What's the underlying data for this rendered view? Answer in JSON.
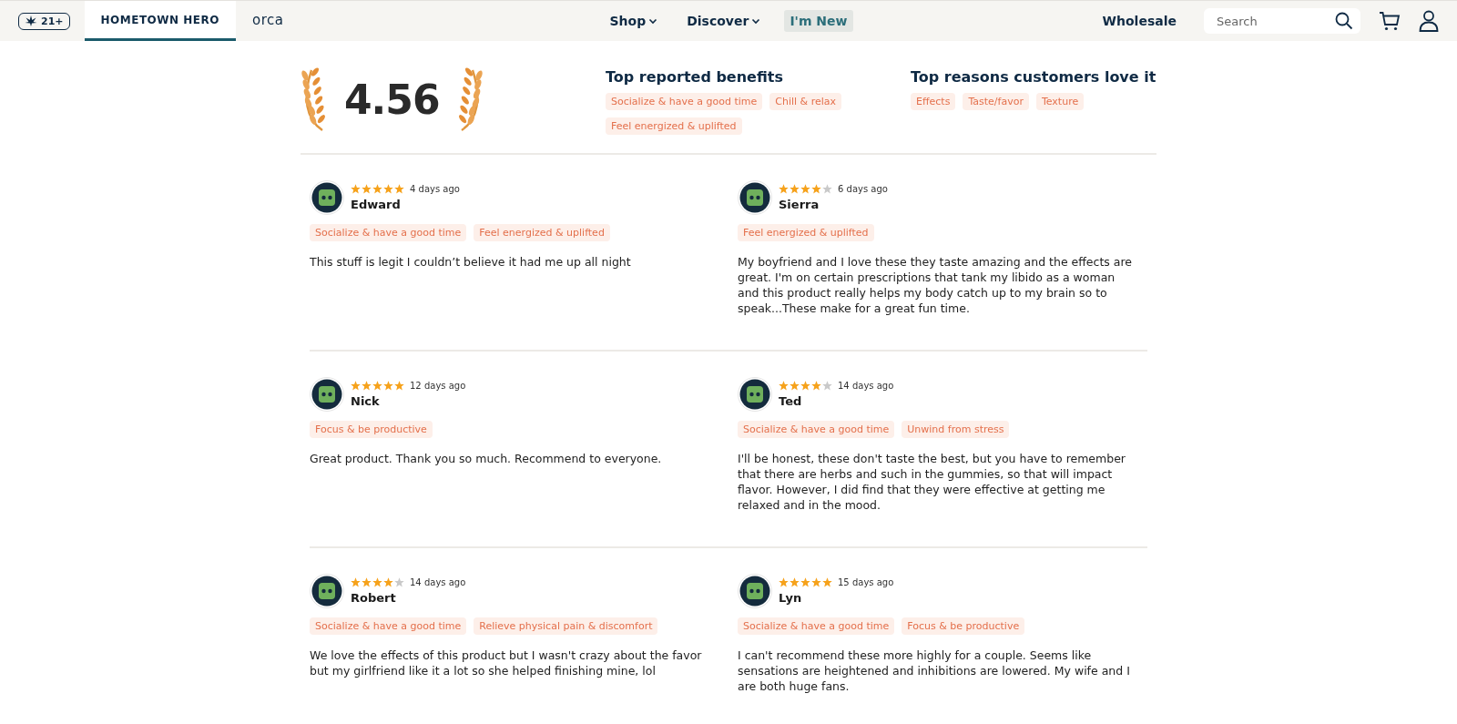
{
  "nav": {
    "age_badge": "21+",
    "brand_tabs": [
      {
        "label": "HOMETOWN HERO",
        "selected": true
      },
      {
        "label": "orca",
        "selected": false
      }
    ],
    "menu": [
      {
        "label": "Shop",
        "kind": "dropdown",
        "selected": false
      },
      {
        "label": "Discover",
        "kind": "dropdown",
        "selected": false
      },
      {
        "label": "I'm New",
        "kind": "link",
        "selected": true
      }
    ],
    "wholesale": "Wholesale",
    "search": {
      "placeholder": "Search"
    }
  },
  "summary": {
    "rating": "4.56",
    "benefits": {
      "title": "Top reported benefits",
      "tags": [
        "Socialize & have a good time",
        "Chill & relax",
        "Feel energized & uplifted"
      ]
    },
    "reasons": {
      "title": "Top reasons customers love it",
      "tags": [
        "Effects",
        "Taste/favor",
        "Texture"
      ]
    }
  },
  "reviews": [
    {
      "name": "Edward",
      "stars": 5,
      "time": "4 days ago",
      "tags": [
        "Socialize & have a good time",
        "Feel energized & uplifted"
      ],
      "text": "This stuff is legit I couldn’t believe it had me up all night"
    },
    {
      "name": "Sierra",
      "stars": 4,
      "time": "6 days ago",
      "tags": [
        "Feel energized & uplifted"
      ],
      "text": "My boyfriend and I love these they taste amazing and the effects are great. I'm on certain prescriptions that tank my libido as a woman and this product really helps my body catch up to my brain so to speak...These make for a great fun time."
    },
    {
      "name": "Nick",
      "stars": 5,
      "time": "12 days ago",
      "tags": [
        "Focus & be productive"
      ],
      "text": "Great product. Thank you so much. Recommend to everyone."
    },
    {
      "name": "Ted",
      "stars": 4,
      "time": "14 days ago",
      "tags": [
        "Socialize & have a good time",
        "Unwind from stress"
      ],
      "text": "I'll be honest, these don't taste the best, but you have to remember that there are herbs and such in the gummies, so that will impact flavor. However, I did find that they were effective at getting me relaxed and in the mood."
    },
    {
      "name": "Robert",
      "stars": 4,
      "time": "14 days ago",
      "tags": [
        "Socialize & have a good time",
        "Relieve physical pain & discomfort"
      ],
      "text": "We love the effects of this product but I wasn't crazy about the favor but my girlfriend like it a lot so she helped finishing mine, lol"
    },
    {
      "name": "Lyn",
      "stars": 5,
      "time": "15 days ago",
      "tags": [
        "Socialize & have a good time",
        "Focus & be productive"
      ],
      "text": "I can't recommend these more highly for a couple. Seems like sensations are heightened and inhibitions are lowered. My wife and I are both huge fans."
    }
  ]
}
